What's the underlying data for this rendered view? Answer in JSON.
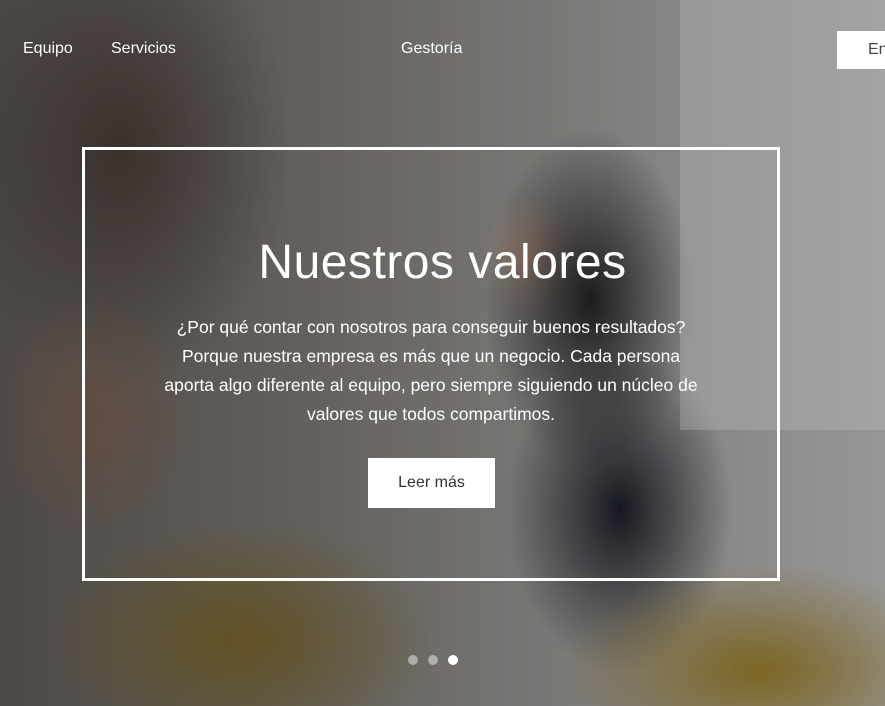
{
  "nav": {
    "items": [
      {
        "label": "Equipo"
      },
      {
        "label": "Servicios"
      },
      {
        "label": "Gestoría"
      }
    ],
    "cta_label": "En"
  },
  "hero": {
    "title": "Nuestros valores",
    "description": "¿Por qué contar con nosotros para conseguir buenos resultados? Porque nuestra empresa es más que un negocio. Cada persona aporta algo diferente al equipo, pero siempre siguiendo un núcleo de valores que todos compartimos.",
    "button_label": "Leer más"
  },
  "carousel": {
    "slide_count": 3,
    "active_index": 3
  },
  "colors": {
    "text": "#ffffff",
    "button_bg": "#ffffff",
    "button_text": "#333333"
  }
}
